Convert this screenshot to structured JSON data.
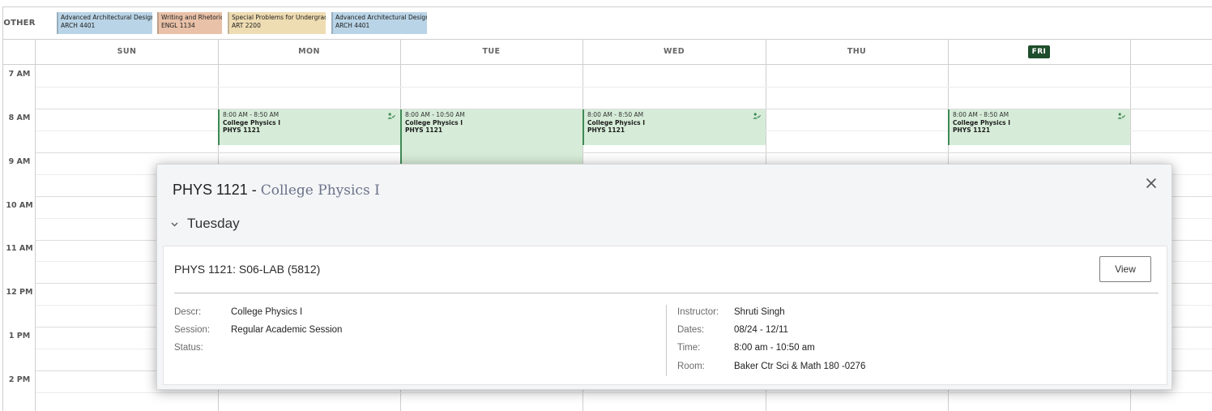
{
  "other": {
    "label": "OTHER",
    "chips": [
      {
        "name": "Advanced Architectural Design",
        "code": "ARCH 4401",
        "color": "#b9d4e6"
      },
      {
        "name": "Writing and Rhetoric",
        "code": "ENGL 1134",
        "color": "#e9c1a8"
      },
      {
        "name": "Special Problems for Undergrad",
        "code": "ART 2200",
        "color": "#eedcb2"
      },
      {
        "name": "Advanced Architectural Design",
        "code": "ARCH 4401",
        "color": "#b9d4e6"
      }
    ]
  },
  "days": [
    "SUN",
    "MON",
    "TUE",
    "WED",
    "THU",
    "FRI"
  ],
  "today": "FRI",
  "times": [
    "7 AM",
    "8 AM",
    "9 AM",
    "10 AM",
    "11 AM",
    "12 PM",
    "1 PM",
    "2 PM"
  ],
  "events": {
    "mon": {
      "time": "8:00 AM - 8:50 AM",
      "title": "College Physics I",
      "code": "PHYS 1121"
    },
    "tue": {
      "time": "8:00 AM - 10:50 AM",
      "title": "College Physics I",
      "code": "PHYS 1121"
    },
    "wed": {
      "time": "8:00 AM - 8:50 AM",
      "title": "College Physics I",
      "code": "PHYS 1121"
    },
    "fri": {
      "time": "8:00 AM - 8:50 AM",
      "title": "College Physics I",
      "code": "PHYS 1121"
    }
  },
  "modal": {
    "course_code": "PHYS 1121 -",
    "course_name": "College Physics I",
    "day": "Tuesday",
    "section": "PHYS 1121: S06-LAB (5812)",
    "view_label": "View",
    "left": [
      {
        "label": "Descr:",
        "value": "College Physics I"
      },
      {
        "label": "Session:",
        "value": "Regular Academic Session"
      },
      {
        "label": "Status:",
        "value": ""
      }
    ],
    "right": [
      {
        "label": "Instructor:",
        "value": "Shruti Singh"
      },
      {
        "label": "Dates:",
        "value": "08/24 - 12/11"
      },
      {
        "label": "Time:",
        "value": "8:00 am - 10:50 am"
      },
      {
        "label": "Room:",
        "value": "Baker Ctr Sci & Math 180 -0276"
      }
    ]
  },
  "colors": {
    "event_bg": "#d6ecd8",
    "event_border": "#3f8a55",
    "today_bg": "#1e4d2b"
  },
  "icons": {
    "event": "person-check-icon",
    "close": "close-icon",
    "toggle": "chevron-down-icon"
  }
}
